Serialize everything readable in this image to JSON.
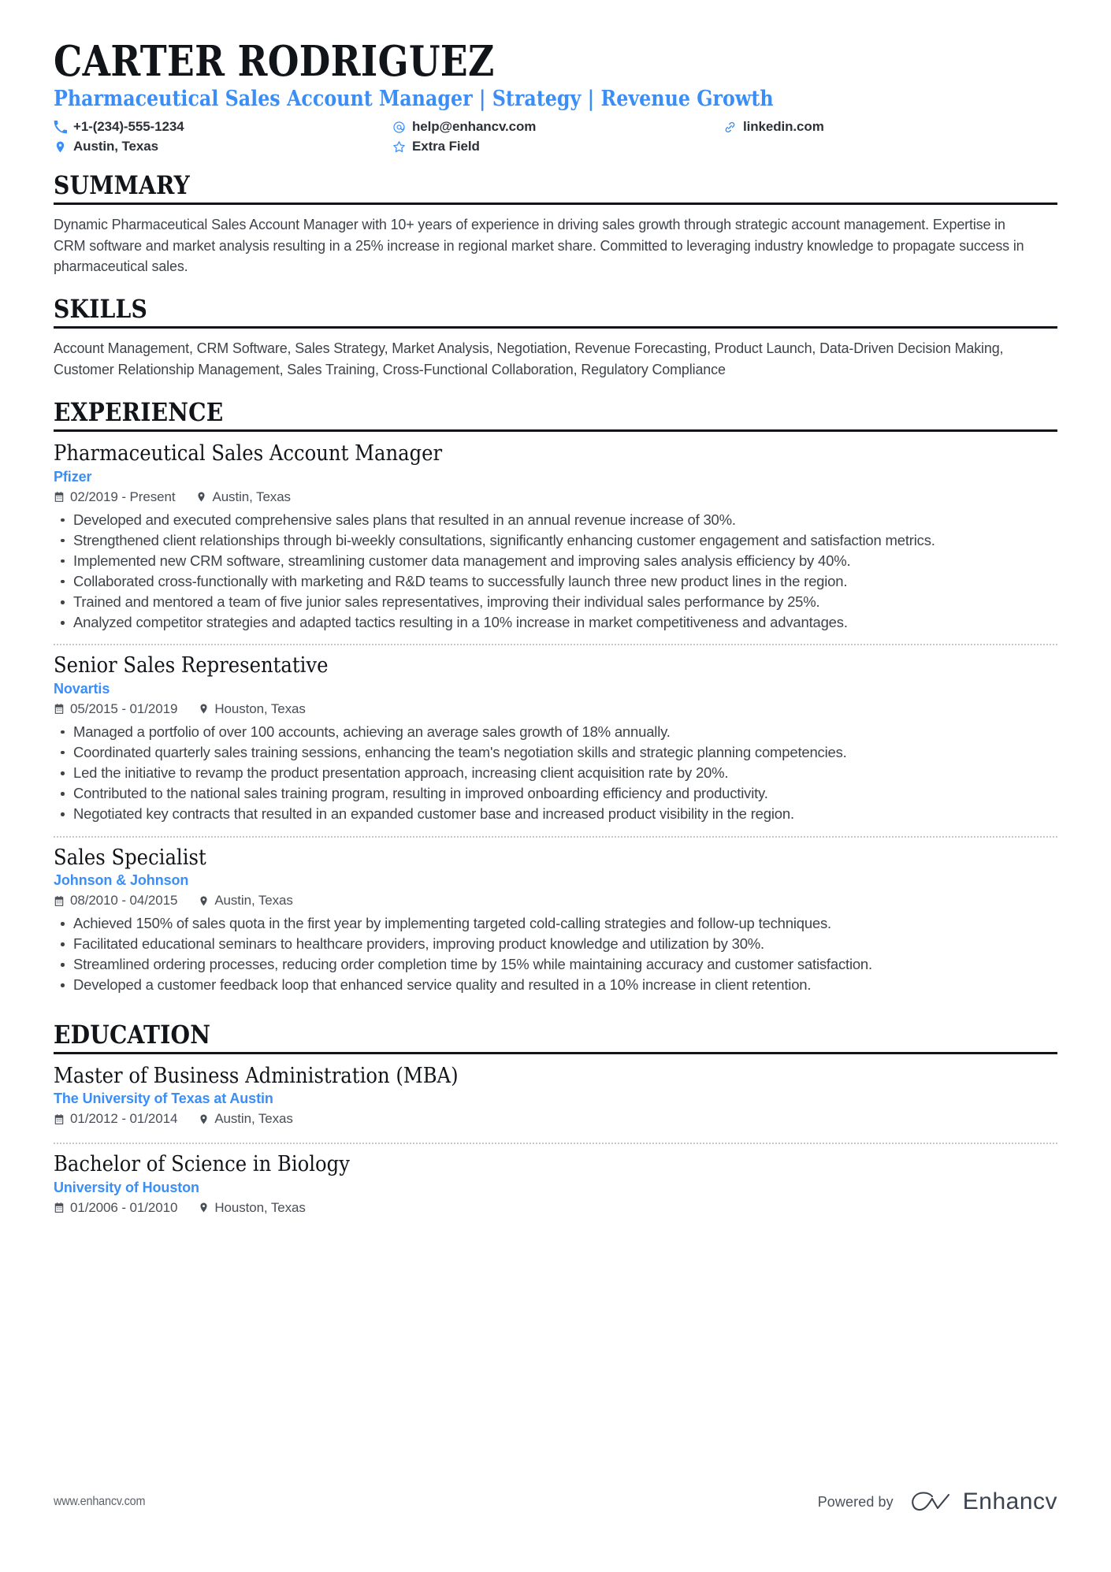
{
  "header": {
    "name": "CARTER RODRIGUEZ",
    "headline": "Pharmaceutical Sales Account Manager | Strategy | Revenue Growth",
    "contacts": [
      {
        "icon": "phone-icon",
        "text": "+1-(234)-555-1234"
      },
      {
        "icon": "email-icon",
        "text": "help@enhancv.com"
      },
      {
        "icon": "link-icon",
        "text": "linkedin.com"
      },
      {
        "icon": "location-icon",
        "text": "Austin, Texas"
      },
      {
        "icon": "star-icon",
        "text": "Extra Field"
      }
    ]
  },
  "sections": {
    "summary": {
      "title": "SUMMARY",
      "text": "Dynamic Pharmaceutical Sales Account Manager with 10+ years of experience in driving sales growth through strategic account management. Expertise in CRM software and market analysis resulting in a 25% increase in regional market share. Committed to leveraging industry knowledge to propagate success in pharmaceutical sales."
    },
    "skills": {
      "title": "SKILLS",
      "text": "Account Management, CRM Software, Sales Strategy, Market Analysis, Negotiation, Revenue Forecasting, Product Launch, Data-Driven Decision Making, Customer Relationship Management, Sales Training, Cross-Functional Collaboration, Regulatory Compliance"
    },
    "experience": {
      "title": "EXPERIENCE",
      "entries": [
        {
          "title": "Pharmaceutical Sales Account Manager",
          "org": "Pfizer",
          "dates": "02/2019 - Present",
          "location": "Austin, Texas",
          "bullets": [
            "Developed and executed comprehensive sales plans that resulted in an annual revenue increase of 30%.",
            "Strengthened client relationships through bi-weekly consultations, significantly enhancing customer engagement and satisfaction metrics.",
            "Implemented new CRM software, streamlining customer data management and improving sales analysis efficiency by 40%.",
            "Collaborated cross-functionally with marketing and R&D teams to successfully launch three new product lines in the region.",
            "Trained and mentored a team of five junior sales representatives, improving their individual sales performance by 25%.",
            "Analyzed competitor strategies and adapted tactics resulting in a 10% increase in market competitiveness and advantages."
          ]
        },
        {
          "title": "Senior Sales Representative",
          "org": "Novartis",
          "dates": "05/2015 - 01/2019",
          "location": "Houston, Texas",
          "bullets": [
            "Managed a portfolio of over 100 accounts, achieving an average sales growth of 18% annually.",
            "Coordinated quarterly sales training sessions, enhancing the team's negotiation skills and strategic planning competencies.",
            "Led the initiative to revamp the product presentation approach, increasing client acquisition rate by 20%.",
            "Contributed to the national sales training program, resulting in improved onboarding efficiency and productivity.",
            "Negotiated key contracts that resulted in an expanded customer base and increased product visibility in the region."
          ]
        },
        {
          "title": "Sales Specialist",
          "org": "Johnson & Johnson",
          "dates": "08/2010 - 04/2015",
          "location": "Austin, Texas",
          "bullets": [
            "Achieved 150% of sales quota in the first year by implementing targeted cold-calling strategies and follow-up techniques.",
            "Facilitated educational seminars to healthcare providers, improving product knowledge and utilization by 30%.",
            "Streamlined ordering processes, reducing order completion time by 15% while maintaining accuracy and customer satisfaction.",
            "Developed a customer feedback loop that enhanced service quality and resulted in a 10% increase in client retention."
          ]
        }
      ]
    },
    "education": {
      "title": "EDUCATION",
      "entries": [
        {
          "title": "Master of Business Administration (MBA)",
          "org": "The University of Texas at Austin",
          "dates": "01/2012 - 01/2014",
          "location": "Austin, Texas"
        },
        {
          "title": "Bachelor of Science in Biology",
          "org": "University of Houston",
          "dates": "01/2006 - 01/2010",
          "location": "Houston, Texas"
        }
      ]
    }
  },
  "footer": {
    "url": "www.enhancv.com",
    "powered_by": "Powered by",
    "brand": "Enhancv"
  },
  "colors": {
    "accent": "#3a8ef6",
    "text": "#3e434a",
    "heading": "#111418"
  }
}
